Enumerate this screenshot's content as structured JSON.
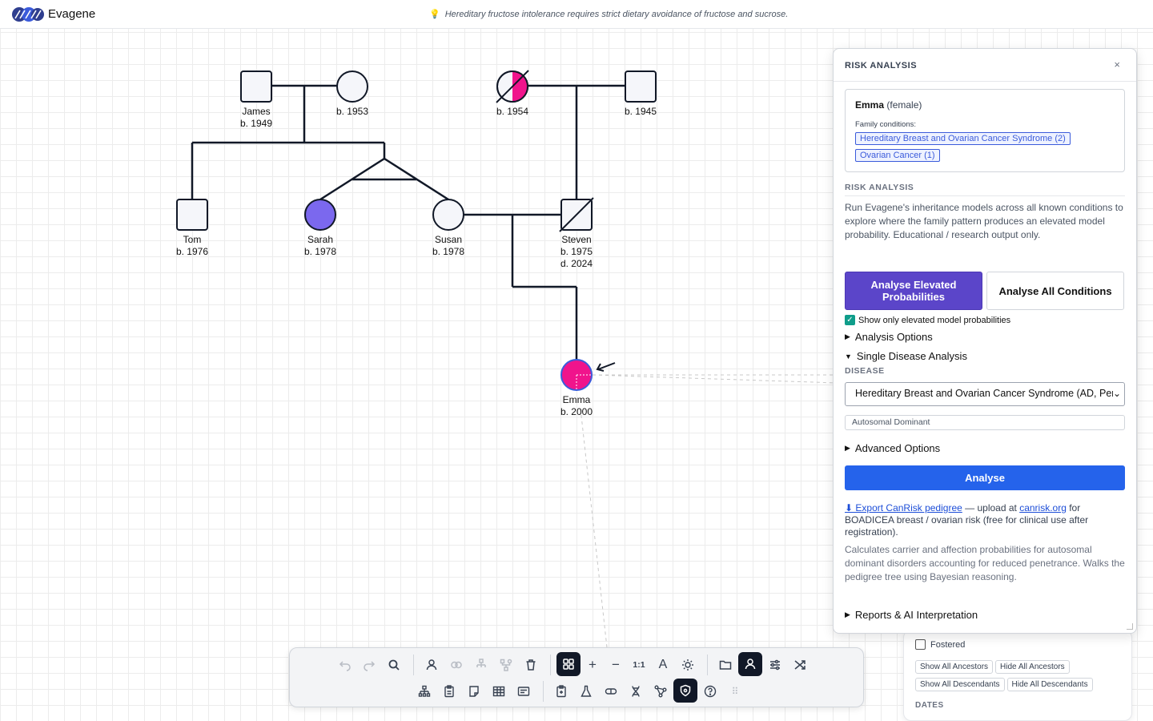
{
  "header": {
    "app_name": "Evagene",
    "tip": "Hereditary fructose intolerance requires strict dietary avoidance of fructose and sucrose."
  },
  "pedigree": {
    "individuals": [
      {
        "id": "james",
        "name": "James",
        "birth": "b. 1949",
        "sex": "male",
        "status": "unaffected"
      },
      {
        "id": "james-wife",
        "name": "",
        "birth": "b. 1953",
        "sex": "female",
        "status": "unaffected"
      },
      {
        "id": "maternal-gm",
        "name": "",
        "birth": "b. 1954",
        "sex": "female",
        "status": "half-affected-deceased"
      },
      {
        "id": "maternal-gf",
        "name": "",
        "birth": "b. 1945",
        "sex": "male",
        "status": "unaffected"
      },
      {
        "id": "tom",
        "name": "Tom",
        "birth": "b. 1976",
        "sex": "male",
        "status": "unaffected"
      },
      {
        "id": "sarah",
        "name": "Sarah",
        "birth": "b. 1978",
        "sex": "female",
        "status": "affected-other"
      },
      {
        "id": "susan",
        "name": "Susan",
        "birth": "b. 1978",
        "sex": "female",
        "status": "unaffected"
      },
      {
        "id": "steven",
        "name": "Steven",
        "birth": "b. 1975",
        "death": "d. 2024",
        "sex": "male",
        "status": "deceased"
      },
      {
        "id": "emma",
        "name": "Emma",
        "birth": "b. 2000",
        "sex": "female",
        "status": "affected-proband"
      }
    ]
  },
  "risk_panel": {
    "title": "RISK ANALYSIS",
    "close": "×",
    "patient_name": "Emma",
    "patient_sex": "(female)",
    "family_conditions_label": "Family conditions:",
    "conditions": [
      "Hereditary Breast and Ovarian Cancer Syndrome (2)",
      "Ovarian Cancer (1)"
    ],
    "section_label": "RISK ANALYSIS",
    "description": "Run Evagene's inheritance models across all known conditions to explore where the family pattern produces an elevated model probability. Educational / research output only.",
    "btn_elevated": "Analyse Elevated Probabilities",
    "btn_all": "Analyse All Conditions",
    "show_only_label": "Show only elevated model probabilities",
    "analysis_options": "Analysis Options",
    "single_disease": "Single Disease Analysis",
    "disease_label": "DISEASE",
    "disease_value": "Hereditary Breast and Ovarian Cancer Syndrome (AD, Pen",
    "inheritance": "Autosomal Dominant",
    "advanced_options": "Advanced Options",
    "analyse": "Analyse",
    "export_link": "⬇ Export CanRisk pedigree",
    "export_mid": " — upload at ",
    "canrisk_link": "canrisk.org",
    "export_tail": " for BOADICEA breast / ovarian risk (free for clinical use after registration).",
    "calc_text": "Calculates carrier and affection probabilities for autosomal dominant disorders accounting for reduced penetrance. Walks the pedigree tree using Bayesian reasoning.",
    "reports": "Reports & AI Interpretation"
  },
  "bg_panel": {
    "fostered": "Fostered",
    "show_ancestors": "Show All Ancestors",
    "hide_ancestors": "Hide All Ancestors",
    "show_descendants": "Show All Descendants",
    "hide_descendants": "Hide All Descendants",
    "dates_label": "DATES"
  },
  "toolbar": {
    "zoom_label": "1:1",
    "text_label": "A",
    "move_grip": "⠿"
  },
  "colors": {
    "affected": "#f0148c",
    "other": "#7b68ee",
    "primary": "#5b45c9",
    "analyse": "#2563eb"
  }
}
